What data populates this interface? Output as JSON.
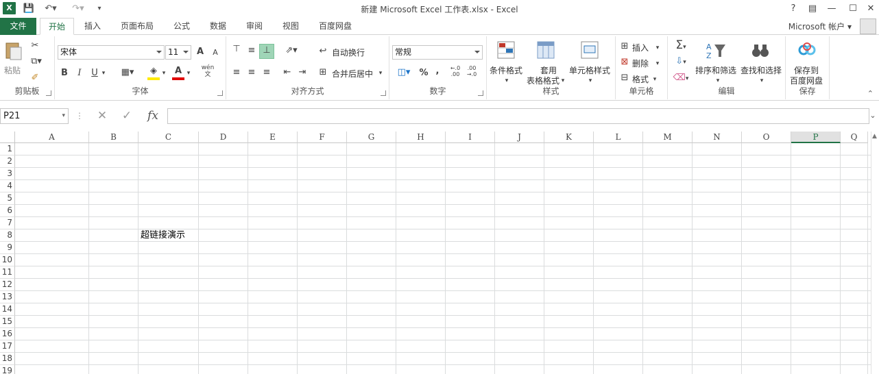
{
  "window": {
    "title": "新建 Microsoft Excel 工作表.xlsx - Excel",
    "help": "?",
    "app_logo": "X"
  },
  "tabs": [
    {
      "label": "文件"
    },
    {
      "label": "开始"
    },
    {
      "label": "插入"
    },
    {
      "label": "页面布局"
    },
    {
      "label": "公式"
    },
    {
      "label": "数据"
    },
    {
      "label": "审阅"
    },
    {
      "label": "视图"
    },
    {
      "label": "百度网盘"
    }
  ],
  "account": "Microsoft 帐户",
  "ribbon": {
    "clipboard": {
      "label": "剪贴板",
      "paste": "粘贴"
    },
    "font": {
      "label": "字体",
      "family": "宋体",
      "size": "11",
      "bold": "B",
      "italic": "I",
      "underline": "U",
      "grow": "A",
      "shrink": "A",
      "font_color": "A",
      "phonetic": "wén 文"
    },
    "alignment": {
      "label": "对齐方式",
      "wrap": "自动换行",
      "merge": "合并后居中"
    },
    "number": {
      "label": "数字",
      "format": "常规",
      "percent": "%",
      "comma": ",",
      "inc_decimal": "←.0 .00",
      "dec_decimal": ".00 →.0"
    },
    "styles": {
      "label": "样式",
      "conditional": "条件格式",
      "table_1": "套用",
      "table_2": "表格格式",
      "cell_styles": "单元格样式"
    },
    "cells": {
      "label": "单元格",
      "insert": "插入",
      "delete": "删除",
      "format": "格式"
    },
    "editing": {
      "label": "编辑",
      "sort": "排序和筛选",
      "find": "查找和选择"
    },
    "save": {
      "label": "保存",
      "save_1": "保存到",
      "save_2": "百度网盘"
    }
  },
  "formula_bar": {
    "name_box": "P21",
    "fx": "fx",
    "value": ""
  },
  "sheet": {
    "columns": [
      "A",
      "B",
      "C",
      "D",
      "E",
      "F",
      "G",
      "H",
      "I",
      "J",
      "K",
      "L",
      "M",
      "N",
      "O",
      "P",
      "Q"
    ],
    "selected_column": "P",
    "rows": [
      "1",
      "2",
      "3",
      "4",
      "5",
      "6",
      "7",
      "8",
      "9",
      "10",
      "11",
      "12",
      "13",
      "14",
      "15",
      "16",
      "17",
      "18",
      "19"
    ],
    "cells": [
      {
        "ref": "C8",
        "value": "超链接演示"
      }
    ]
  },
  "colors": {
    "accent": "#217346",
    "selected_fill": "#9fd5b7"
  }
}
